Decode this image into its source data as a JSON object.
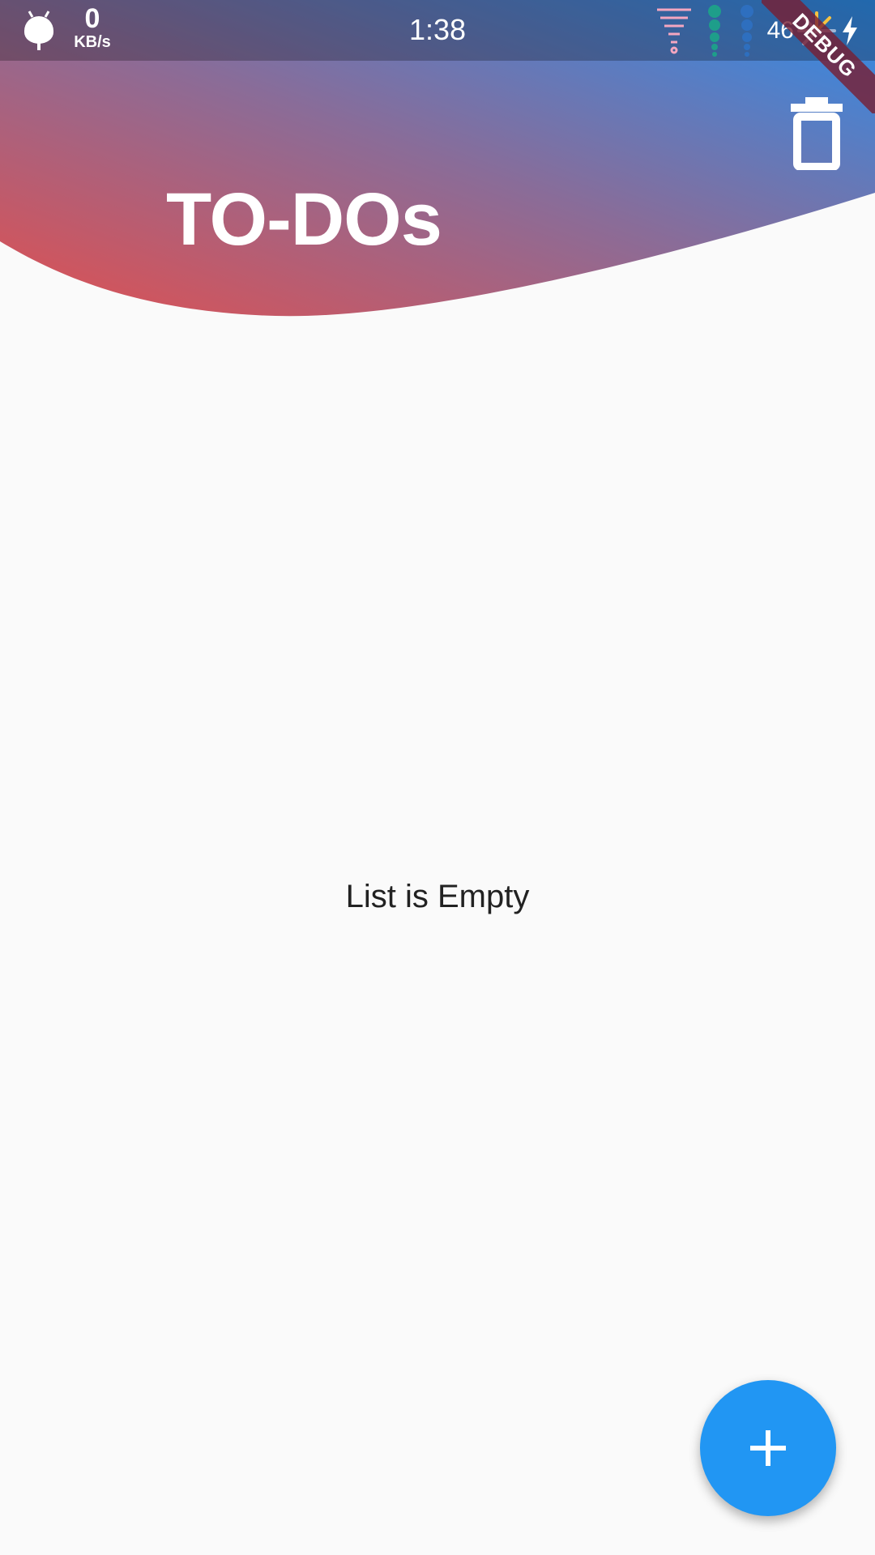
{
  "status_bar": {
    "time": "1:38",
    "net_speed_value": "0",
    "net_speed_unit": "KB/s",
    "battery_level": "46",
    "icons": [
      "android-icon",
      "notification-icon",
      "signal-dots-icon",
      "signal-dots-icon",
      "pinwheel-icon",
      "charging-icon"
    ]
  },
  "header": {
    "title": "TO-DOs",
    "gradient_start": "#e05050",
    "gradient_mid": "#8a6c98",
    "gradient_end": "#2d8ce8",
    "actions": [
      {
        "icon": "delete-icon"
      }
    ]
  },
  "debug_banner": {
    "label": "DEBUG"
  },
  "main": {
    "empty_message": "List is Empty"
  },
  "fab": {
    "icon": "plus-icon",
    "color": "#2196f3"
  }
}
